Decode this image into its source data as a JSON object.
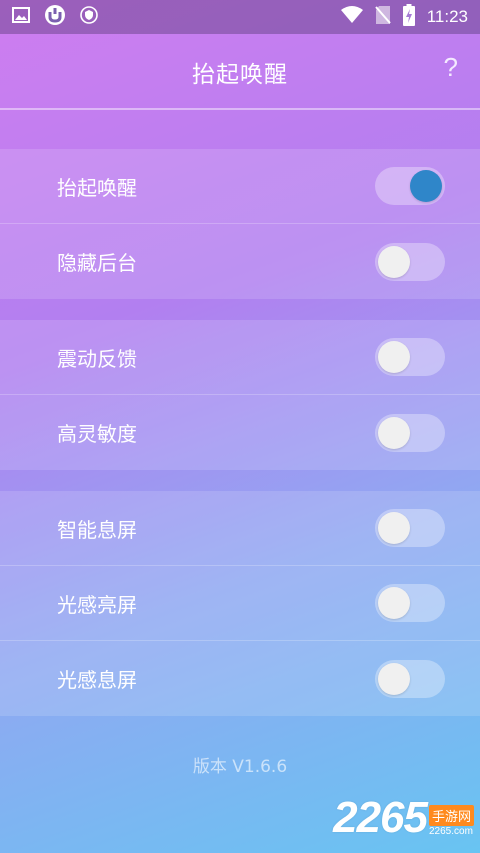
{
  "status_bar": {
    "time": "11:23",
    "left_icons": [
      "image-icon",
      "torrent-app-icon",
      "shield-app-icon"
    ],
    "right_icons": [
      "wifi-icon",
      "no-sim-icon",
      "battery-charging-icon"
    ]
  },
  "header": {
    "title": "抬起唤醒",
    "help_label": "?"
  },
  "groups": [
    {
      "items": [
        {
          "label": "抬起唤醒",
          "on": true
        },
        {
          "label": "隐藏后台",
          "on": false
        }
      ]
    },
    {
      "items": [
        {
          "label": "震动反馈",
          "on": false
        },
        {
          "label": "高灵敏度",
          "on": false
        }
      ]
    },
    {
      "items": [
        {
          "label": "智能息屏",
          "on": false
        },
        {
          "label": "光感亮屏",
          "on": false
        },
        {
          "label": "光感息屏",
          "on": false
        }
      ]
    }
  ],
  "footer": {
    "version": "版本 V1.6.6"
  },
  "watermark": {
    "number": "2265",
    "cn": "手游网",
    "en": "2265.com"
  },
  "colors": {
    "toggle_on_knob": "#2f86c9",
    "gradient_top": "#cf7df0",
    "gradient_bottom": "#68c4f2"
  }
}
